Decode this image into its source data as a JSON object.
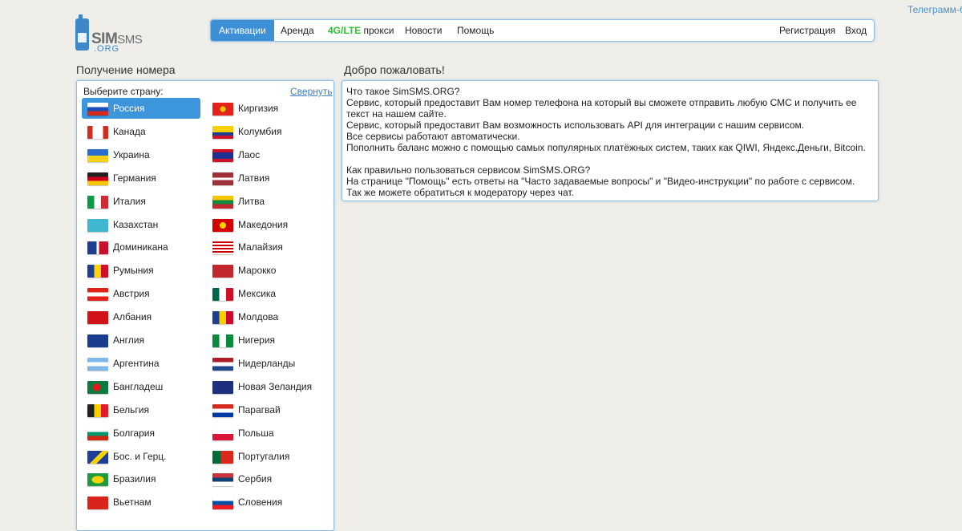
{
  "header": {
    "telegram_link": "Телеграмм-бот"
  },
  "logo": {
    "sim": "SIM",
    "sms": "SMS",
    "org": ".ORG"
  },
  "nav": {
    "items": [
      "Активации",
      "Аренда",
      "4G/LTE",
      "прокси",
      "Новости",
      "Помощь"
    ],
    "right": [
      "Регистрация",
      "Вход"
    ]
  },
  "left": {
    "title": "Получение номера",
    "choose_label": "Выберите страну:",
    "collapse_link": "Свернуть",
    "selected": "Россия",
    "countries_col1": [
      "Россия",
      "Канада",
      "Украина",
      "Германия",
      "Италия",
      "Казахстан",
      "Доминикана",
      "Румыния",
      "Австрия",
      "Албания",
      "Англия",
      "Аргентина",
      "Бангладеш",
      "Бельгия",
      "Болгария",
      "Бос. и Герц.",
      "Бразилия",
      "Вьетнам"
    ],
    "countries_col2": [
      "Киргизия",
      "Колумбия",
      "Лаос",
      "Латвия",
      "Литва",
      "Македония",
      "Малайзия",
      "Марокко",
      "Мексика",
      "Молдова",
      "Нигерия",
      "Нидерланды",
      "Новая Зеландия",
      "Парагвай",
      "Польша",
      "Португалия",
      "Сербия",
      "Словения"
    ]
  },
  "right": {
    "title": "Добро пожаловать!",
    "q1": "Что такое SimSMS.ORG?",
    "lines1": [
      "Сервис, который предоставит Вам номер телефона на который вы сможете отправить любую СМС и получить ее текст на нашем сайте.",
      "Сервис, который предоставит Вам возможность использовать API для интеграции с нашим сервисом.",
      "Все сервисы работают автоматически.",
      "Пополнить баланс можно с помощью самых популярных платёжных систем, таких как QIWI, Яндекс.Деньги, Bitcoin."
    ],
    "q2": "Как правильно пользоваться сервисом SimSMS.ORG?",
    "lines2": [
      "На странице \"Помощь\" есть ответы на \"Часто задаваемые вопросы\" и \"Видео-инструкции\" по работе с сервисом.",
      "Так же можете обратиться к модератору через чат."
    ]
  },
  "colors": {
    "accent": "#3d8fd6",
    "border": "#8cc0e8",
    "lte": "#2ec42e",
    "background": "#efeee9"
  }
}
